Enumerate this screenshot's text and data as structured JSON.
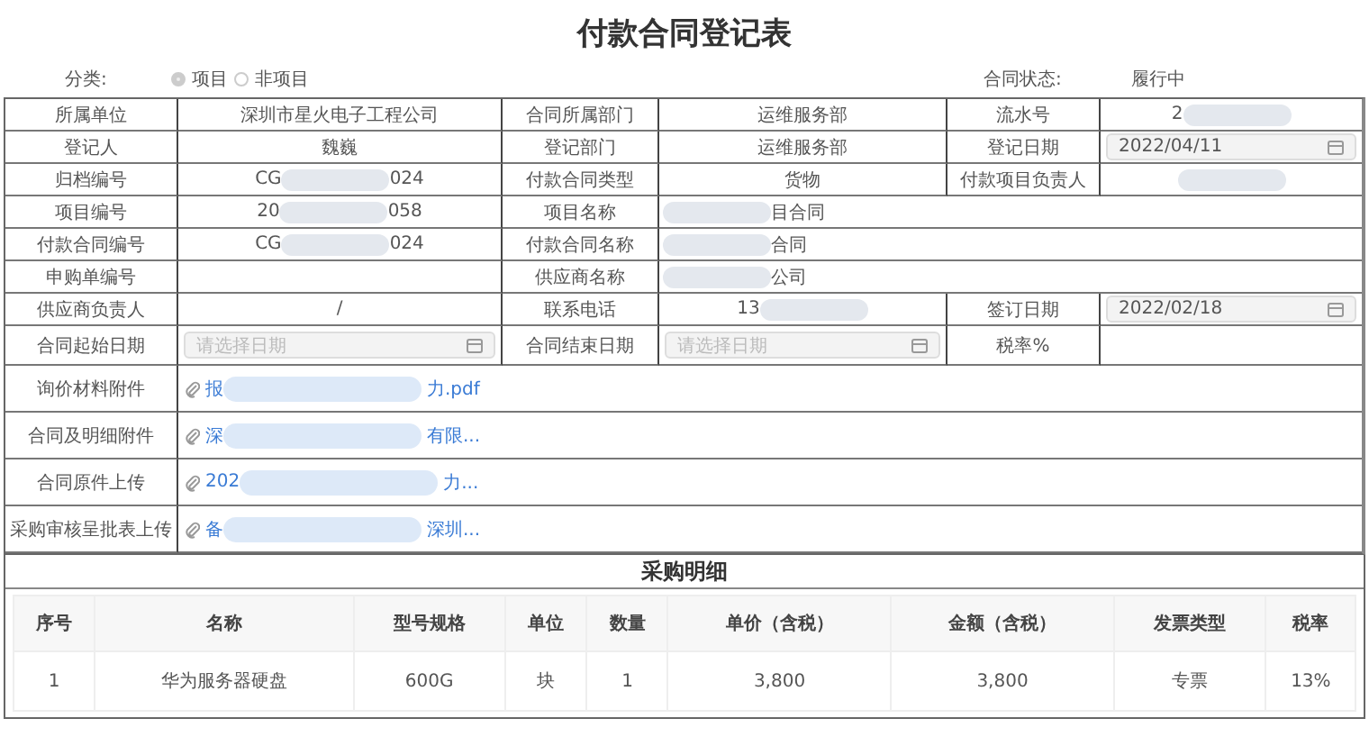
{
  "title": "付款合同登记表",
  "classification": {
    "label": "分类:",
    "options": [
      {
        "label": "项目",
        "selected": true
      },
      {
        "label": "非项目",
        "selected": false
      }
    ]
  },
  "status": {
    "label": "合同状态:",
    "value": "履行中"
  },
  "rows": [
    {
      "cells": [
        {
          "kind": "label",
          "text": "所属单位"
        },
        {
          "kind": "value",
          "segments": [
            {
              "kind": "text",
              "text": "深圳市星火电子工程公司"
            }
          ]
        },
        {
          "kind": "label",
          "text": "合同所属部门"
        },
        {
          "kind": "value",
          "segments": [
            {
              "kind": "text",
              "text": "运维服务部"
            }
          ]
        },
        {
          "kind": "label",
          "text": "流水号"
        },
        {
          "kind": "value",
          "segments": [
            {
              "kind": "text",
              "text": "2"
            },
            {
              "kind": "blur"
            }
          ]
        }
      ]
    },
    {
      "cells": [
        {
          "kind": "label",
          "text": "登记人"
        },
        {
          "kind": "value",
          "segments": [
            {
              "kind": "text",
              "text": "魏巍"
            }
          ]
        },
        {
          "kind": "label",
          "text": "登记部门"
        },
        {
          "kind": "value",
          "segments": [
            {
              "kind": "text",
              "text": "运维服务部"
            }
          ]
        },
        {
          "kind": "label",
          "text": "登记日期"
        },
        {
          "kind": "date",
          "value": "2022/04/11"
        }
      ]
    },
    {
      "cells": [
        {
          "kind": "label",
          "text": "归档编号"
        },
        {
          "kind": "value",
          "segments": [
            {
              "kind": "text",
              "text": "CG"
            },
            {
              "kind": "blur"
            },
            {
              "kind": "text",
              "text": "024"
            }
          ]
        },
        {
          "kind": "label",
          "text": "付款合同类型"
        },
        {
          "kind": "value",
          "segments": [
            {
              "kind": "text",
              "text": "货物"
            }
          ]
        },
        {
          "kind": "label",
          "text": "付款项目负责人"
        },
        {
          "kind": "value",
          "segments": [
            {
              "kind": "blur"
            }
          ]
        }
      ]
    },
    {
      "cells": [
        {
          "kind": "label",
          "text": "项目编号"
        },
        {
          "kind": "value",
          "segments": [
            {
              "kind": "text",
              "text": "20"
            },
            {
              "kind": "blur"
            },
            {
              "kind": "text",
              "text": "058"
            }
          ]
        },
        {
          "kind": "label",
          "text": "项目名称"
        },
        {
          "kind": "wide",
          "segments": [
            {
              "kind": "blur"
            },
            {
              "kind": "text",
              "text": "目合同"
            }
          ]
        }
      ]
    },
    {
      "cells": [
        {
          "kind": "label",
          "text": "付款合同编号"
        },
        {
          "kind": "value",
          "segments": [
            {
              "kind": "text",
              "text": "CG"
            },
            {
              "kind": "blur"
            },
            {
              "kind": "text",
              "text": "024"
            }
          ]
        },
        {
          "kind": "label",
          "text": "付款合同名称"
        },
        {
          "kind": "wide",
          "segments": [
            {
              "kind": "blur"
            },
            {
              "kind": "text",
              "text": "合同"
            }
          ]
        }
      ]
    },
    {
      "cells": [
        {
          "kind": "label",
          "text": "申购单编号"
        },
        {
          "kind": "value"
        },
        {
          "kind": "label",
          "text": "供应商名称"
        },
        {
          "kind": "wide",
          "segments": [
            {
              "kind": "blur"
            },
            {
              "kind": "text",
              "text": "公司"
            }
          ]
        }
      ]
    },
    {
      "cells": [
        {
          "kind": "label",
          "text": "供应商负责人"
        },
        {
          "kind": "value",
          "segments": [
            {
              "kind": "text",
              "text": "/"
            }
          ]
        },
        {
          "kind": "label",
          "text": "联系电话"
        },
        {
          "kind": "value",
          "segments": [
            {
              "kind": "text",
              "text": "13"
            },
            {
              "kind": "blur"
            }
          ]
        },
        {
          "kind": "label",
          "text": "签订日期"
        },
        {
          "kind": "date",
          "value": "2022/02/18"
        }
      ]
    },
    {
      "cells": [
        {
          "kind": "label",
          "text": "合同起始日期"
        },
        {
          "kind": "date",
          "placeholder": "请选择日期"
        },
        {
          "kind": "label",
          "text": "合同结束日期"
        },
        {
          "kind": "date",
          "placeholder": "请选择日期"
        },
        {
          "kind": "label",
          "text": "税率%"
        },
        {
          "kind": "value"
        }
      ]
    }
  ],
  "attachments": [
    {
      "label": "询价材料附件",
      "parts": [
        "报",
        "力.pdf"
      ]
    },
    {
      "label": "合同及明细附件",
      "parts": [
        "深",
        "有限..."
      ]
    },
    {
      "label": "合同原件上传",
      "parts": [
        "202",
        "力..."
      ]
    },
    {
      "label": "采购审核呈批表上传",
      "parts": [
        "备",
        "深圳..."
      ]
    }
  ],
  "details": {
    "title": "采购明细",
    "columns": [
      "序号",
      "名称",
      "型号规格",
      "单位",
      "数量",
      "单价（含税）",
      "金额（含税）",
      "发票类型",
      "税率"
    ],
    "rows": [
      [
        "1",
        "华为服务器硬盘",
        "600G",
        "块",
        "1",
        "3,800",
        "3,800",
        "专票",
        "13%"
      ]
    ]
  }
}
